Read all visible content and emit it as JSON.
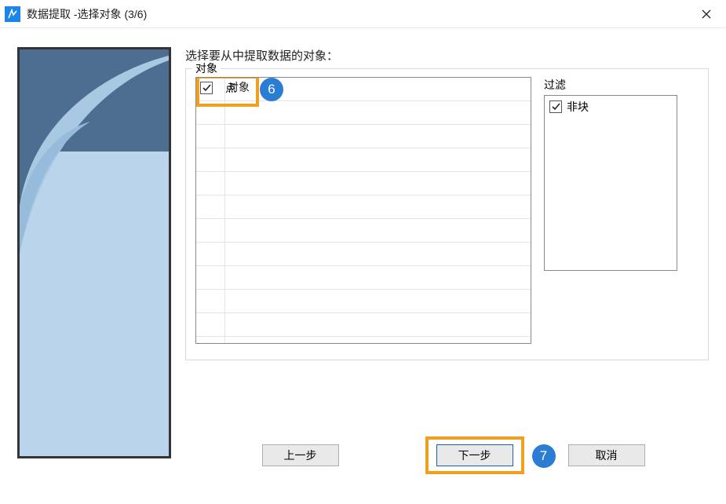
{
  "titlebar": {
    "title": "数据提取 -选择对象 (3/6)"
  },
  "instruction": "选择要从中提取数据的对象：",
  "objectsLegend": "对象",
  "objectList": {
    "header": "对象",
    "rows": [
      {
        "checked": true,
        "label": "点"
      }
    ]
  },
  "filter": {
    "label": "过滤",
    "rows": [
      {
        "checked": true,
        "label": "非块"
      }
    ]
  },
  "buttons": {
    "prev": "上一步",
    "next": "下一步",
    "cancel": "取消"
  },
  "badges": {
    "six": "6",
    "seven": "7"
  }
}
